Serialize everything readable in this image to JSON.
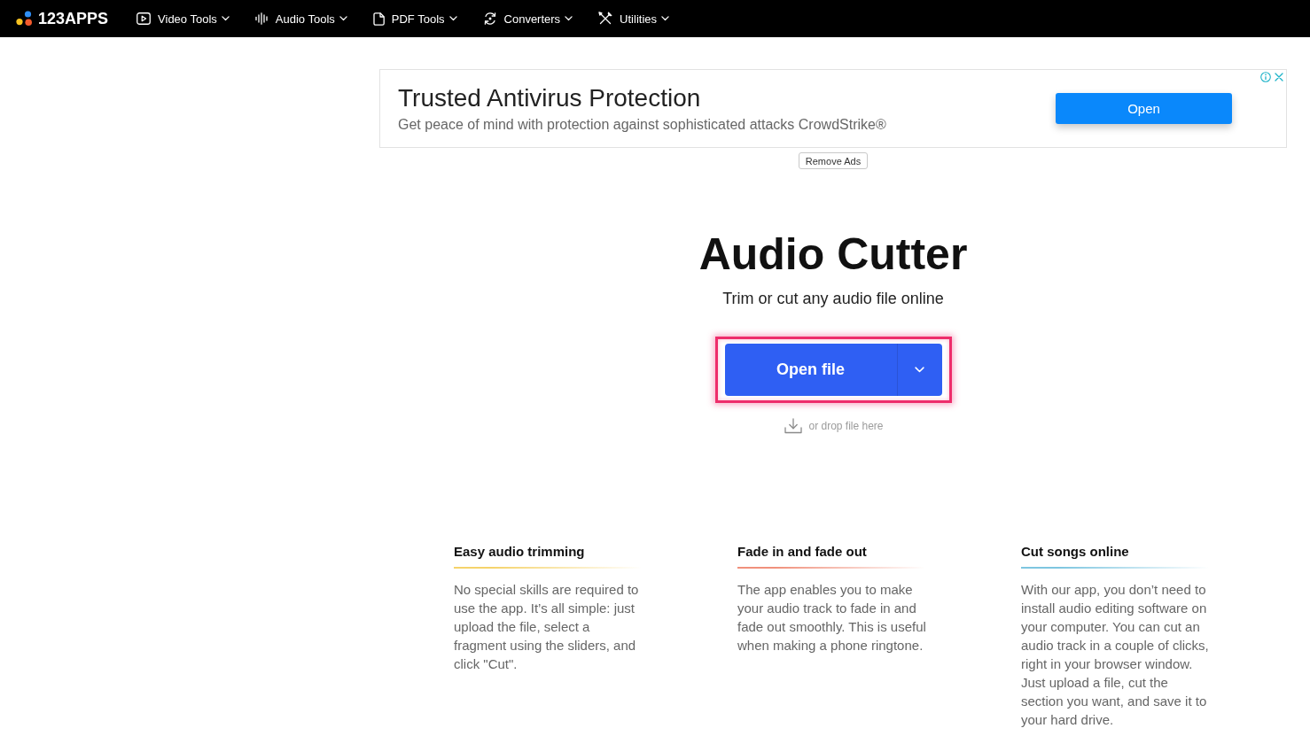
{
  "nav": {
    "logo": "123APPS",
    "items": [
      {
        "label": "Video Tools"
      },
      {
        "label": "Audio Tools"
      },
      {
        "label": "PDF Tools"
      },
      {
        "label": "Converters"
      },
      {
        "label": "Utilities"
      }
    ]
  },
  "ad": {
    "title": "Trusted Antivirus Protection",
    "text": "Get peace of mind with protection against sophisticated attacks CrowdStrike®",
    "button": "Open"
  },
  "remove_ads_button": "Remove Ads",
  "tool": {
    "title": "Audio Cutter",
    "subtitle": "Trim or cut any audio file online",
    "open_button": {
      "label": "Open file",
      "highlighted": true
    },
    "drop_hint": "or drop file here"
  },
  "features": [
    {
      "title": "Easy audio trimming",
      "color": "#f5d36b",
      "text": "No special skills are required to use the app. It’s all simple: just upload the file, select a fragment using the sliders, and click \"Cut\"."
    },
    {
      "title": "Fade in and fade out",
      "color": "#f0917c",
      "text": "The app enables you to make your audio track to fade in and fade out smoothly. This is useful when making a phone ringtone."
    },
    {
      "title": "Cut songs online",
      "color": "#7ec6e0",
      "text": "With our app, you don’t need to install audio editing software on your computer. You can cut an audio track in a couple of clicks, right in your browser window. Just upload a file, cut the section you want, and save it to your hard drive."
    }
  ]
}
